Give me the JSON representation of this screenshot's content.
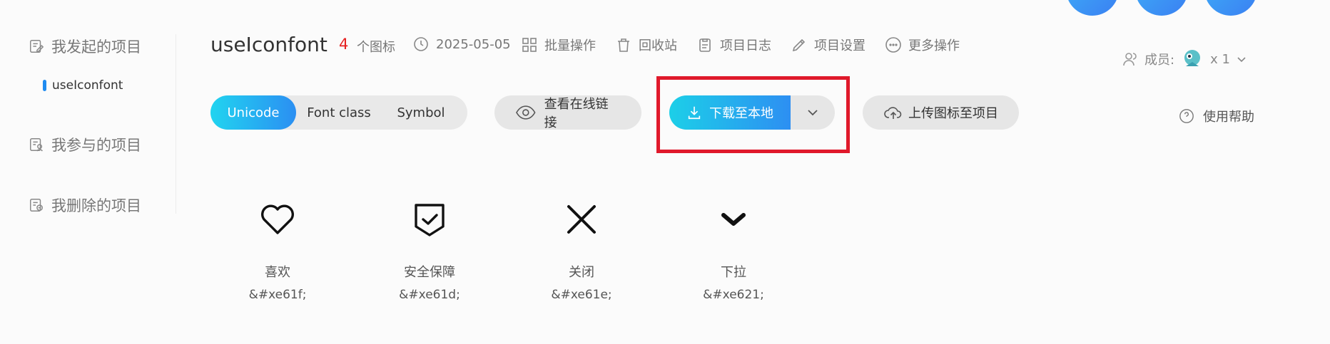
{
  "sidebar": {
    "my_projects": "我发起的项目",
    "current_project": "useIconfont",
    "joined_projects": "我参与的项目",
    "deleted_projects": "我删除的项目"
  },
  "header": {
    "title": "useIconfont",
    "icon_count": "4",
    "icon_count_label": "个图标",
    "date": "2025-05-05",
    "actions": {
      "batch": "批量操作",
      "recycle": "回收站",
      "log": "项目日志",
      "settings": "项目设置",
      "more": "更多操作"
    },
    "members_label": "成员:",
    "members_count": "x 1",
    "help": "使用帮助"
  },
  "toolbar": {
    "tabs": [
      "Unicode",
      "Font class",
      "Symbol"
    ],
    "view_link": "查看在线链接",
    "download": "下载至本地",
    "upload": "上传图标至项目"
  },
  "icons": [
    {
      "name": "喜欢",
      "code": "&#xe61f;",
      "icon": "heart-icon"
    },
    {
      "name": "安全保障",
      "code": "&#xe61d;",
      "icon": "shield-check-icon"
    },
    {
      "name": "关闭",
      "code": "&#xe61e;",
      "icon": "close-icon"
    },
    {
      "name": "下拉",
      "code": "&#xe621;",
      "icon": "chevron-down-icon"
    }
  ],
  "colors": {
    "accent_start": "#21d4f0",
    "accent_end": "#2b8ff2",
    "count": "#e62222",
    "highlight": "#e0192b"
  }
}
